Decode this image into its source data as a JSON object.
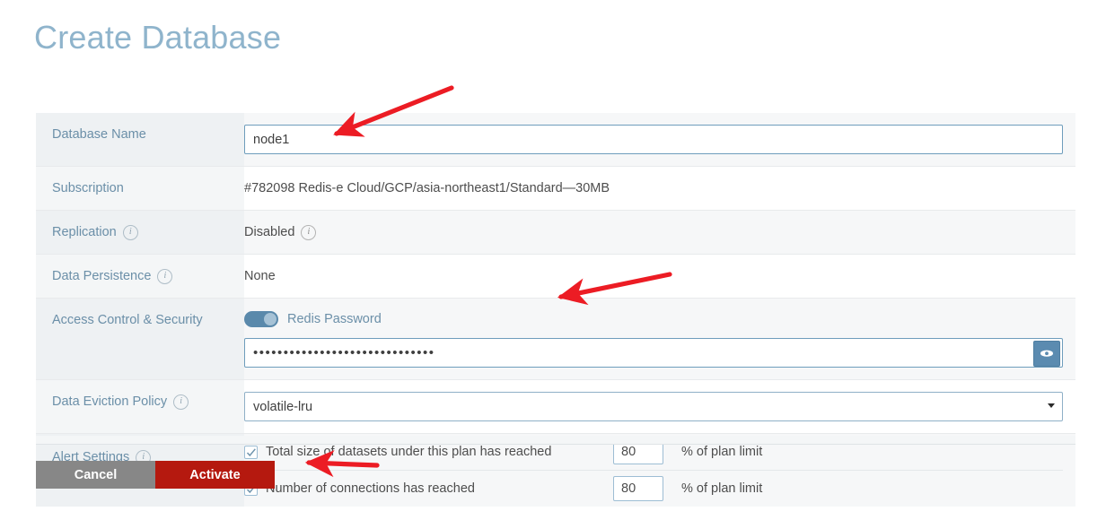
{
  "page": {
    "title": "Create Database"
  },
  "form": {
    "rows": [
      {
        "label": "Database Name",
        "type": "text",
        "value": "node1",
        "has_info": false
      },
      {
        "label": "Subscription",
        "type": "static",
        "value": "#782098 Redis-e Cloud/GCP/asia-northeast1/Standard—30MB",
        "has_info": false
      },
      {
        "label": "Replication",
        "type": "static-info",
        "value": "Disabled",
        "has_info": true
      },
      {
        "label": "Data Persistence",
        "type": "static",
        "value": "None",
        "has_info": true
      },
      {
        "label": "Access Control & Security",
        "type": "password",
        "toggle_label": "Redis Password",
        "toggle_on": true,
        "value": "••••••••••••••••••••••••••••••",
        "reveal_icon": "eye-icon"
      },
      {
        "label": "Data Eviction Policy",
        "type": "select",
        "value": "volatile-lru",
        "has_info": true
      },
      {
        "label": "Alert Settings",
        "type": "alerts",
        "has_info": true
      }
    ]
  },
  "alerts": {
    "items": [
      {
        "checked": true,
        "text": "Total size of datasets under this plan has reached",
        "value": "80",
        "suffix": "% of plan limit"
      },
      {
        "checked": true,
        "text": "Number of connections has reached",
        "value": "80",
        "suffix": "% of plan limit"
      }
    ]
  },
  "buttons": {
    "cancel": "Cancel",
    "activate": "Activate"
  },
  "colors": {
    "title": "#8fb4cc",
    "label": "#6b8fa8",
    "activate": "#b5190f",
    "cancel": "#878787",
    "toggle_on": "#5a89ab",
    "annotation_arrow": "#ec1c24"
  },
  "annotations": {
    "arrows": [
      {
        "name": "arrow-to-database-name",
        "points_to": "database-name-input"
      },
      {
        "name": "arrow-to-password",
        "points_to": "redis-password-input"
      },
      {
        "name": "arrow-to-activate",
        "points_to": "activate-button"
      }
    ]
  }
}
